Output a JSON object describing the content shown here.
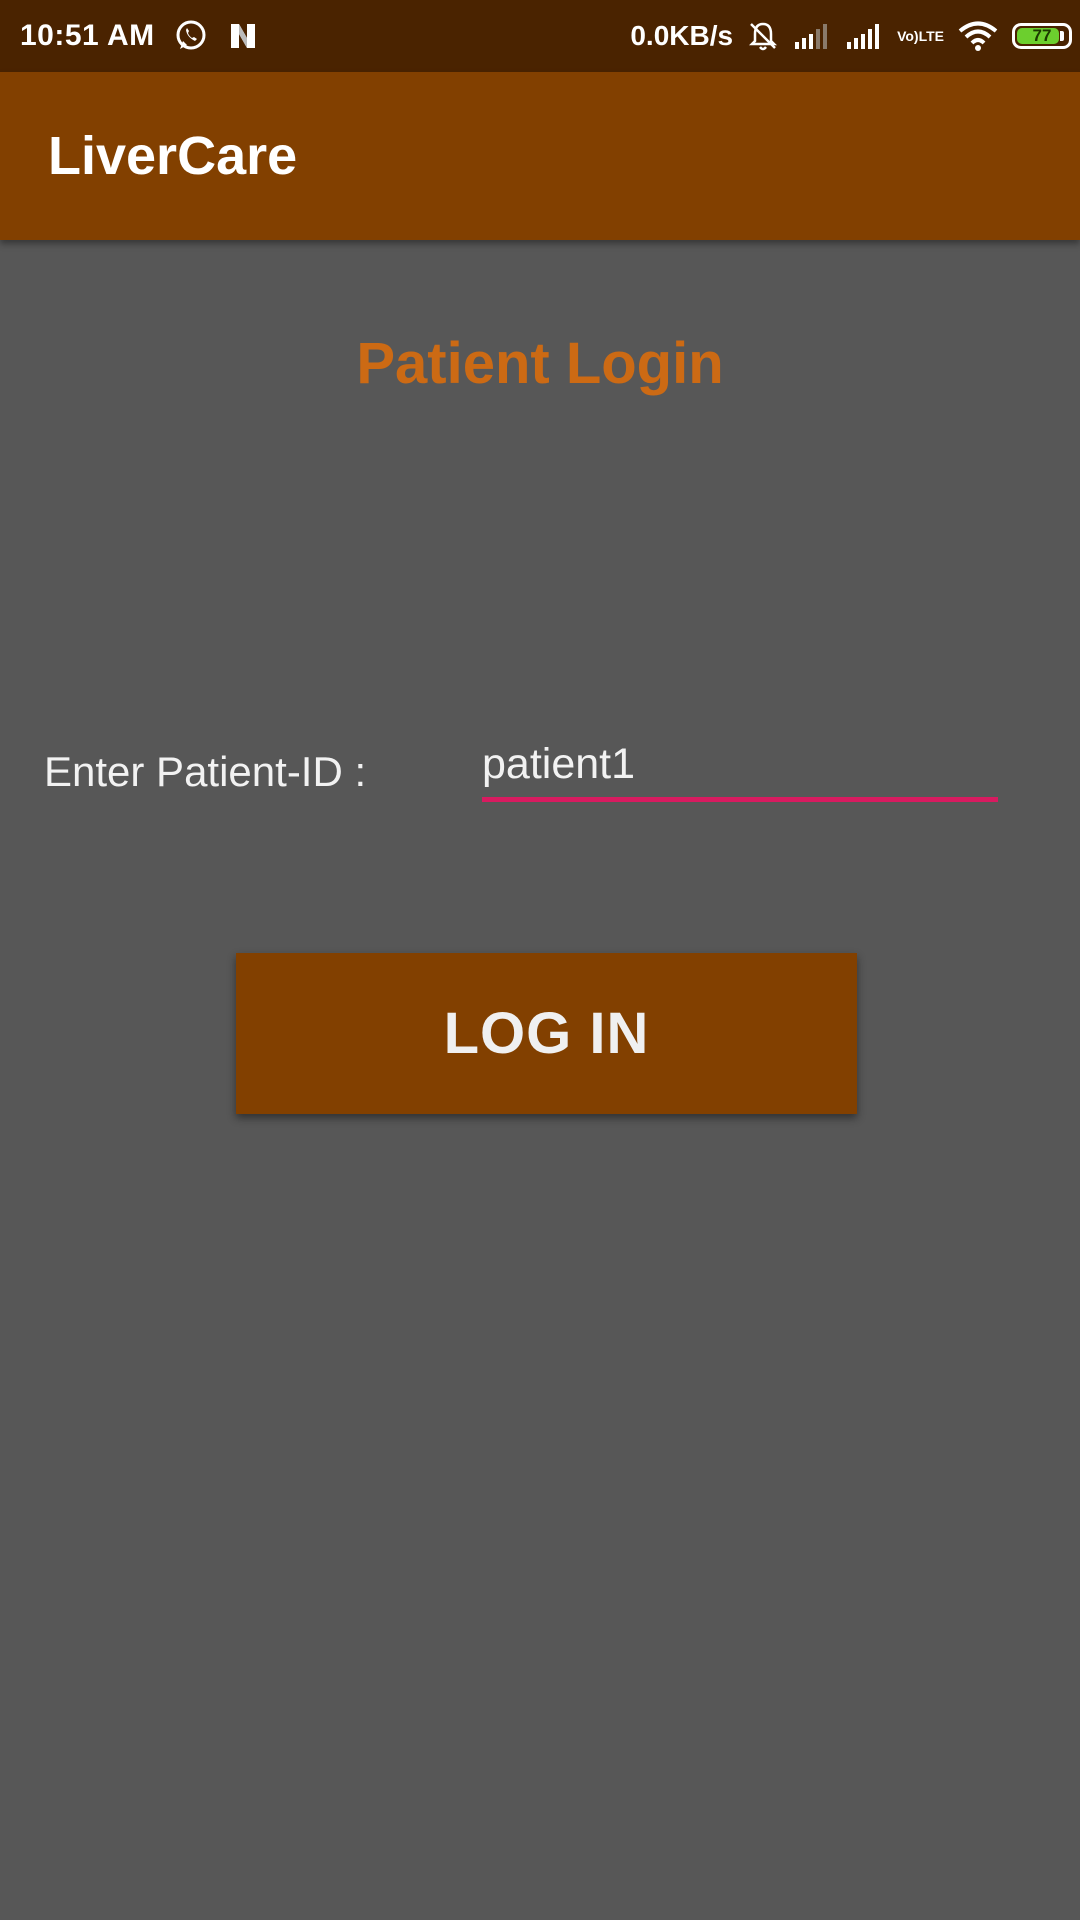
{
  "status_bar": {
    "time": "10:51 AM",
    "net_speed": "0.0KB/s",
    "volte_line1": "Vo)",
    "volte_line2": "LTE",
    "battery_level": "77",
    "icons": [
      "whatsapp-icon",
      "notification-n-icon",
      "mute-bell-icon",
      "signal-icon",
      "signal-icon",
      "volte-icon",
      "wifi-icon",
      "battery-icon"
    ]
  },
  "app_bar": {
    "title": "LiverCare",
    "color": "#824000"
  },
  "login": {
    "heading": "Patient Login",
    "heading_color": "#cc6a14",
    "id_label": "Enter Patient-ID :",
    "id_value": "patient1",
    "underline_color": "#d81b60",
    "button_label": "LOG IN"
  }
}
